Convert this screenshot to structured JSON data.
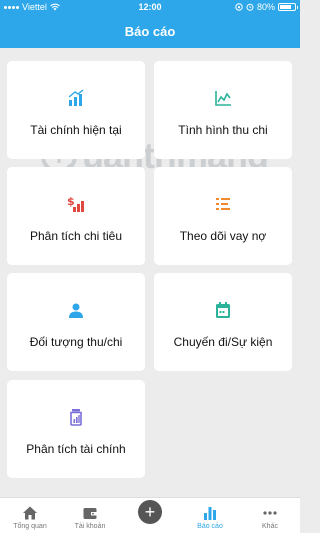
{
  "status": {
    "carrier": "Viettel",
    "time": "12:00",
    "battery": "80%",
    "battery_level": 0.8
  },
  "header": {
    "title": "Báo cáo"
  },
  "cards": [
    {
      "label": "Tài chính hiện tại",
      "icon": "bar-chart-icon",
      "color": "#2ea7ea"
    },
    {
      "label": "Tình hình thu chi",
      "icon": "line-chart-icon",
      "color": "#2bb39a"
    },
    {
      "label": "Phân tích chi tiêu",
      "icon": "expense-chart-icon",
      "color": "#e0473e"
    },
    {
      "label": "Theo dõi vay nợ",
      "icon": "list-icon",
      "color": "#f08a2c"
    },
    {
      "label": "Đối tượng thu/chi",
      "icon": "person-icon",
      "color": "#2ea7ea"
    },
    {
      "label": "Chuyến đi/Sự kiện",
      "icon": "calendar-icon",
      "color": "#2bb39a"
    },
    {
      "label": "Phân tích tài chính",
      "icon": "jar-icon",
      "color": "#7a6fd6"
    }
  ],
  "watermark": {
    "text": "uantrimang"
  },
  "tabs": [
    {
      "label": "Tổng quan",
      "icon": "home-icon"
    },
    {
      "label": "Tài khoản",
      "icon": "wallet-icon"
    },
    {
      "label": "",
      "icon": "add-icon"
    },
    {
      "label": "Báo cáo",
      "icon": "report-icon"
    },
    {
      "label": "Khác",
      "icon": "more-icon"
    }
  ],
  "colors": {
    "accent": "#2ea7ea",
    "background": "#ececec"
  }
}
